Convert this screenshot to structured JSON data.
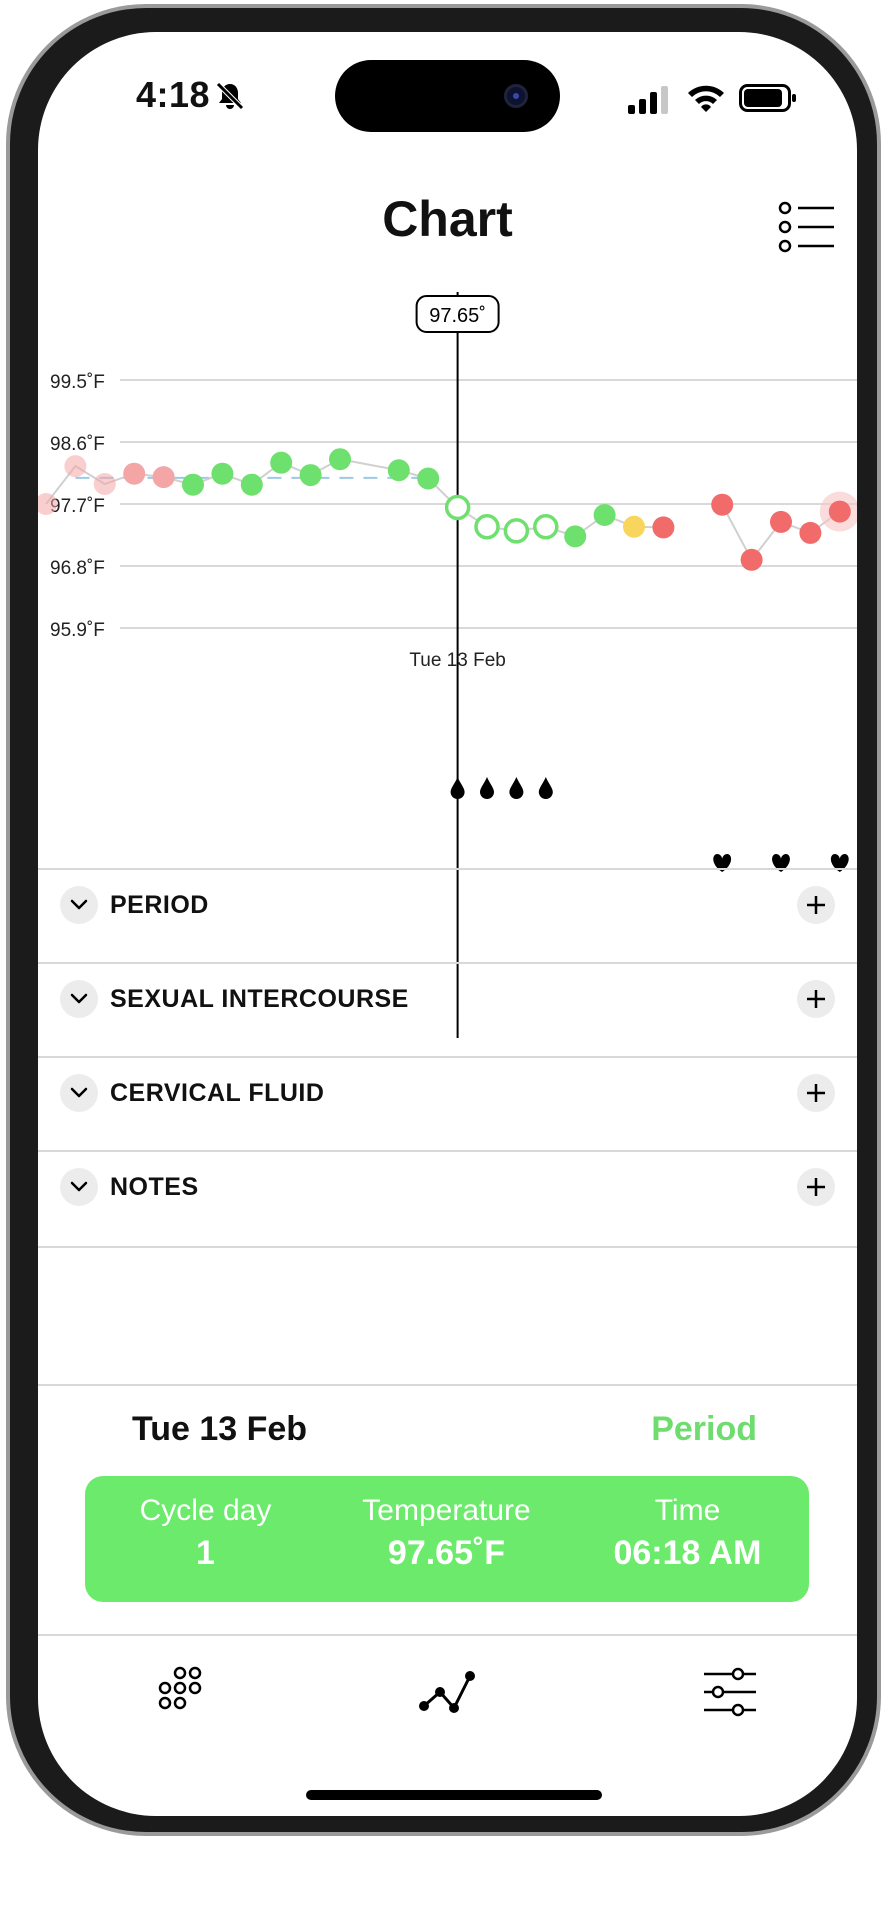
{
  "status": {
    "time": "4:18"
  },
  "header": {
    "title": "Chart"
  },
  "chart_data": {
    "type": "scatter",
    "y_ticks": [
      "99.5˚F",
      "98.6˚F",
      "97.7˚F",
      "96.8˚F",
      "95.9˚F"
    ],
    "y_values": [
      99.5,
      98.6,
      97.7,
      96.8,
      95.9
    ],
    "ylim": [
      95.9,
      99.5
    ],
    "baseline": 98.08,
    "selected": {
      "label": "97.65˚",
      "date": "Tue 13 Feb",
      "index": 14
    },
    "points": [
      {
        "i": 0,
        "v": 97.7,
        "color": "#f4a6a6",
        "kind": "faded"
      },
      {
        "i": 1,
        "v": 98.25,
        "color": "#f4a6a6",
        "kind": "faded"
      },
      {
        "i": 2,
        "v": 97.99,
        "color": "#f4a6a6",
        "kind": "faded"
      },
      {
        "i": 3,
        "v": 98.14,
        "color": "#f4a6a6",
        "kind": "filled"
      },
      {
        "i": 4,
        "v": 98.09,
        "color": "#f4a6a6",
        "kind": "filled"
      },
      {
        "i": 5,
        "v": 97.98,
        "color": "#6ee06e",
        "kind": "filled"
      },
      {
        "i": 6,
        "v": 98.14,
        "color": "#6ee06e",
        "kind": "filled"
      },
      {
        "i": 7,
        "v": 97.98,
        "color": "#6ee06e",
        "kind": "filled"
      },
      {
        "i": 8,
        "v": 98.3,
        "color": "#6ee06e",
        "kind": "filled"
      },
      {
        "i": 9,
        "v": 98.12,
        "color": "#6ee06e",
        "kind": "filled"
      },
      {
        "i": 10,
        "v": 98.35,
        "color": "#6ee06e",
        "kind": "filled"
      },
      {
        "i": 12,
        "v": 98.19,
        "color": "#6ee06e",
        "kind": "filled"
      },
      {
        "i": 13,
        "v": 98.07,
        "color": "#6ee06e",
        "kind": "filled"
      },
      {
        "i": 14,
        "v": 97.65,
        "color": "#6ee06e",
        "kind": "hollow"
      },
      {
        "i": 15,
        "v": 97.37,
        "color": "#6ee06e",
        "kind": "hollow"
      },
      {
        "i": 16,
        "v": 97.31,
        "color": "#6ee06e",
        "kind": "hollow"
      },
      {
        "i": 17,
        "v": 97.37,
        "color": "#6ee06e",
        "kind": "hollow"
      },
      {
        "i": 18,
        "v": 97.23,
        "color": "#6ee06e",
        "kind": "filled"
      },
      {
        "i": 19,
        "v": 97.54,
        "color": "#6ee06e",
        "kind": "filled"
      },
      {
        "i": 20,
        "v": 97.37,
        "color": "#f8d55c",
        "kind": "filled"
      },
      {
        "i": 21,
        "v": 97.36,
        "color": "#f26b6b",
        "kind": "filled"
      },
      {
        "i": 23,
        "v": 97.69,
        "color": "#f26b6b",
        "kind": "filled"
      },
      {
        "i": 24,
        "v": 96.89,
        "color": "#f26b6b",
        "kind": "filled"
      },
      {
        "i": 25,
        "v": 97.44,
        "color": "#f26b6b",
        "kind": "filled"
      },
      {
        "i": 26,
        "v": 97.28,
        "color": "#f26b6b",
        "kind": "filled"
      },
      {
        "i": 27,
        "v": 97.59,
        "color": "#f26b6b",
        "kind": "filled"
      }
    ],
    "period_marks": [
      14,
      15,
      16,
      17
    ],
    "intercourse_marks": [
      23,
      25,
      27
    ]
  },
  "sections": [
    {
      "label": "PERIOD"
    },
    {
      "label": "SEXUAL INTERCOURSE"
    },
    {
      "label": "CERVICAL FLUID"
    },
    {
      "label": "NOTES"
    }
  ],
  "summary": {
    "date": "Tue 13 Feb",
    "type": "Period",
    "cycle_day_label": "Cycle day",
    "cycle_day": "1",
    "temperature_label": "Temperature",
    "temperature": "97.65˚F",
    "time_label": "Time",
    "time": "06:18 AM"
  },
  "colors": {
    "accent": "#6cea6c",
    "period": "#f26b6b",
    "low_fertility": "#f8d55c"
  },
  "tabs": [
    {
      "icon": "calendar-dots-icon"
    },
    {
      "icon": "chart-line-icon"
    },
    {
      "icon": "sliders-icon"
    }
  ]
}
